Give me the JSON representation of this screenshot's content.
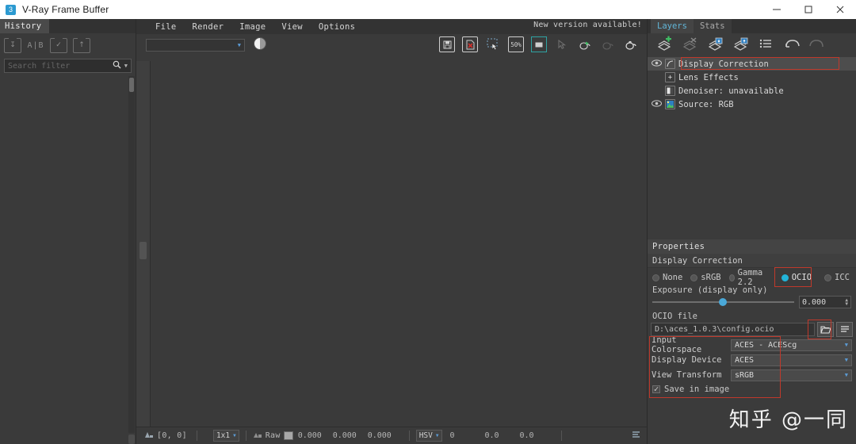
{
  "window": {
    "title": "V-Ray Frame Buffer",
    "app_icon": "vray-icon",
    "minimize": "–",
    "maximize": "□",
    "close": "✕"
  },
  "history": {
    "tab_label": "History",
    "tools": [
      {
        "name": "save-to-history-icon",
        "glyph": "⤓"
      },
      {
        "name": "ab-compare-label",
        "glyph": "A|B"
      },
      {
        "name": "history-check-icon",
        "glyph": "✓"
      },
      {
        "name": "history-load-icon",
        "glyph": "⤒"
      }
    ],
    "search_placeholder": "Search filter",
    "search_value": "",
    "search_icon": "search-icon",
    "dropdown_icon": "chevron-down-icon"
  },
  "menu": {
    "items": [
      "File",
      "Render",
      "Image",
      "View",
      "Options"
    ],
    "notice": "New version available!"
  },
  "toolbar": {
    "channel_combo_value": "",
    "channel_combo_icon": "chevron-down-icon",
    "sphere_button": "color-sphere-icon",
    "icons": [
      {
        "name": "save-image-icon",
        "glyph": "💾",
        "label": ""
      },
      {
        "name": "save-image-red-icon",
        "glyph": "",
        "label": ""
      },
      {
        "name": "region-select-icon",
        "glyph": "",
        "label": ""
      },
      {
        "name": "zoom-level-icon",
        "glyph": "",
        "label": "50%"
      },
      {
        "name": "fit-view-icon",
        "glyph": "",
        "label": ""
      },
      {
        "name": "pick-region-icon",
        "glyph": "",
        "label": ""
      },
      {
        "name": "render-teapot-start-icon",
        "glyph": "",
        "label": ""
      },
      {
        "name": "render-teapot-stop-icon",
        "glyph": "",
        "label": ""
      },
      {
        "name": "render-teapot-icon",
        "glyph": "",
        "label": ""
      }
    ]
  },
  "statusbar": {
    "pixel_icon": "pixel-probe-icon",
    "coords": "[0, 0]",
    "sample_size": "1x1",
    "sample_icon": "sample-icon",
    "mode": "Raw",
    "swatch_color": "#a8a8a8",
    "rgb": [
      "0.000",
      "0.000",
      "0.000"
    ],
    "color_model": "HSV",
    "hsv": [
      "0",
      "0.0",
      "0.0"
    ],
    "right_icon": "list-icon"
  },
  "right_panel": {
    "tabs": [
      {
        "label": "Layers",
        "active": true
      },
      {
        "label": "Stats",
        "active": false
      }
    ],
    "toolbar_icons": [
      {
        "name": "add-layer-icon"
      },
      {
        "name": "remove-layer-icon"
      },
      {
        "name": "load-layers-icon"
      },
      {
        "name": "save-layers-icon"
      },
      {
        "name": "layer-presets-icon"
      },
      {
        "name": "undo-icon"
      },
      {
        "name": "redo-icon"
      }
    ],
    "layers": [
      {
        "name": "Display Correction",
        "icon": "curve-icon",
        "eye": true,
        "selected": true,
        "indent": false,
        "highlight": true
      },
      {
        "name": "Lens Effects",
        "icon": "plus-icon",
        "eye": false,
        "selected": false,
        "indent": true,
        "highlight": false
      },
      {
        "name": "Denoiser: unavailable",
        "icon": "denoiser-icon",
        "eye": false,
        "selected": false,
        "indent": true,
        "highlight": false
      },
      {
        "name": "Source: RGB",
        "icon": "source-rgb-icon",
        "eye": true,
        "selected": false,
        "indent": true,
        "highlight": false
      }
    ]
  },
  "properties": {
    "title": "Properties",
    "subtitle": "Display Correction",
    "modes": [
      {
        "label": "None",
        "selected": false
      },
      {
        "label": "sRGB",
        "selected": false
      },
      {
        "label": "Gamma 2.2",
        "selected": false
      },
      {
        "label": "OCIO",
        "selected": true
      },
      {
        "label": "ICC",
        "selected": false
      }
    ],
    "accent_color": "#22b3d8",
    "highlight_color": "#c0392b",
    "exposure_label": "Exposure (display only)",
    "exposure_value": "0.000",
    "exposure_slider_pct": 47,
    "ocio_file_label": "OCIO file",
    "ocio_file_path": "D:\\aces_1.0.3\\config.ocio",
    "browse_icon": "folder-open-icon",
    "menu_icon": "hamburger-icon",
    "fields": [
      {
        "label": "Input Colorspace",
        "value": "ACES - ACEScg",
        "icon": "chevron-down-icon"
      },
      {
        "label": "Display Device",
        "value": "ACES",
        "icon": "chevron-down-icon"
      },
      {
        "label": "View Transform",
        "value": "sRGB",
        "icon": "chevron-down-icon"
      }
    ],
    "save_in_image_label": "Save in image",
    "save_in_image_checked": true
  },
  "watermark": "知乎 @一同"
}
